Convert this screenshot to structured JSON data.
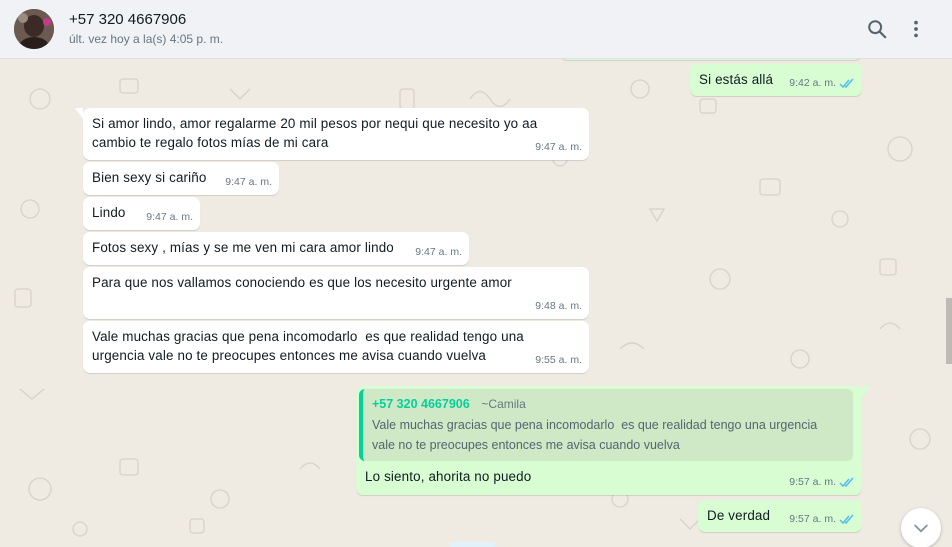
{
  "header": {
    "contact_name": "+57 320 4667906",
    "status": "últ. vez hoy a la(s) 4:05 p. m.",
    "search_icon": "search-icon",
    "menu_icon": "kebab-menu-icon"
  },
  "colors": {
    "incoming_bubble": "#ffffff",
    "outgoing_bubble": "#d9fdd3",
    "read_ticks": "#53bdeb",
    "quote_accent": "#06cf9c",
    "chat_background": "#efeae2"
  },
  "messages": [
    {
      "direction": "out",
      "text": "Si estás allá",
      "time": "9:42 a. m.",
      "status": "read"
    },
    {
      "direction": "in",
      "text": "Si amor lindo, amor regalarme 20 mil pesos por nequi que necesito yo aa\ncambio te regalo fotos mías de mi cara",
      "time": "9:47 a. m."
    },
    {
      "direction": "in",
      "text": "Bien sexy si cariño",
      "time": "9:47 a. m."
    },
    {
      "direction": "in",
      "text": "Lindo",
      "time": "9:47 a. m."
    },
    {
      "direction": "in",
      "text": "Fotos sexy , mías y se me ven mi cara amor lindo",
      "time": "9:47 a. m."
    },
    {
      "direction": "in",
      "text": "Para que nos vallamos conociendo es que los necesito urgente amor",
      "time": "9:48 a. m."
    },
    {
      "direction": "in",
      "text": "Vale muchas gracias que pena incomodarlo  es que realidad tengo una\nurgencia vale no te preocupes entonces me avisa cuando vuelva",
      "time": "9:55 a. m."
    },
    {
      "direction": "out",
      "quote": {
        "author": "+57 320 4667906",
        "alias": "~Camila",
        "text": "Vale muchas gracias que pena incomodarlo  es que realidad tengo una urgencia\nvale no te preocupes entonces me avisa cuando vuelva"
      },
      "text": "Lo siento, ahorita no puedo",
      "time": "9:57 a. m.",
      "status": "read"
    },
    {
      "direction": "out",
      "text": "De verdad",
      "time": "9:57 a. m.",
      "status": "read"
    }
  ],
  "scroll_button_icon": "chevron-down-icon"
}
